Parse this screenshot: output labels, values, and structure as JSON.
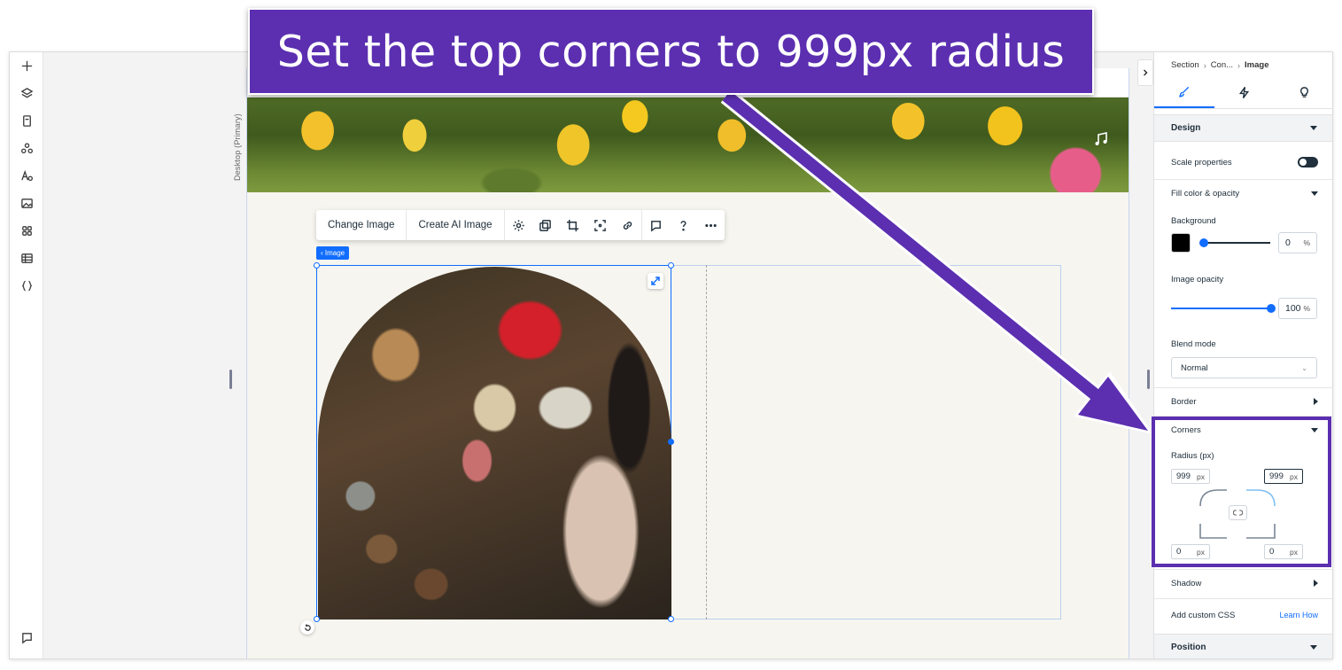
{
  "annotation": {
    "callout_text": "Set the top corners to 999px radius"
  },
  "left_toolbar": {
    "items": [
      {
        "name": "add-icon"
      },
      {
        "name": "layers-icon"
      },
      {
        "name": "pages-icon"
      },
      {
        "name": "apps-market-icon"
      },
      {
        "name": "text-theme-icon"
      },
      {
        "name": "media-icon"
      },
      {
        "name": "apps-icon"
      },
      {
        "name": "cms-icon"
      },
      {
        "name": "code-icon"
      }
    ],
    "bottom": {
      "name": "chat-icon"
    }
  },
  "canvas": {
    "desktop_label": "Desktop (Primary)",
    "floating_toolbar": {
      "change_image": "Change Image",
      "create_ai_image": "Create AI Image"
    },
    "image_tag": "‹ Image"
  },
  "panel": {
    "breadcrumb": [
      "Section",
      "Con...",
      "Image"
    ],
    "tabs": [
      {
        "name": "design-tab",
        "icon": "brush-icon",
        "active": true
      },
      {
        "name": "interactions-tab",
        "icon": "lightning-icon",
        "active": false
      },
      {
        "name": "help-tab",
        "icon": "lightbulb-icon",
        "active": false
      }
    ],
    "design": {
      "header": "Design",
      "scale_properties": "Scale properties",
      "fill_color_opacity": "Fill color & opacity",
      "background_label": "Background",
      "background_color": "#000000",
      "background_opacity": "0",
      "percent": "%",
      "image_opacity_label": "Image opacity",
      "image_opacity": "100",
      "blend_mode_label": "Blend mode",
      "blend_mode": "Normal",
      "border": "Border",
      "corners": "Corners",
      "radius_label": "Radius (px)",
      "radius_top_left": "999",
      "radius_top_right": "999",
      "radius_bottom_left": "0",
      "radius_bottom_right": "0",
      "unit_px": "px",
      "shadow": "Shadow",
      "add_custom_css": "Add custom CSS",
      "learn_how": "Learn How"
    },
    "position_header": "Position"
  },
  "colors": {
    "accent": "#116dff",
    "annotation": "#5b2fb0"
  }
}
